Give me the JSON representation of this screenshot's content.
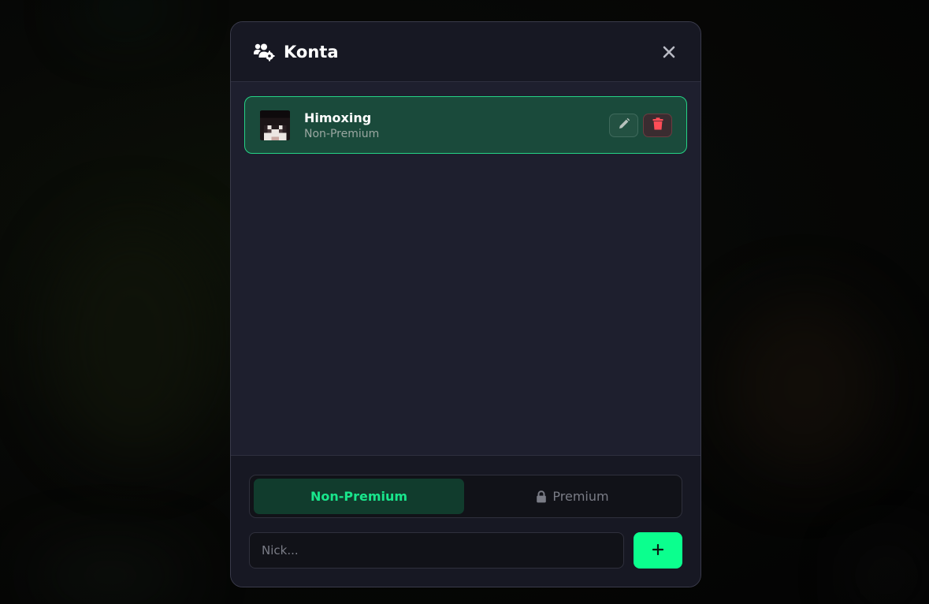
{
  "modal": {
    "title": "Konta",
    "header_icon": "users-gear-icon",
    "close_icon": "close-icon"
  },
  "accounts": [
    {
      "name": "Himoxing",
      "type": "Non-Premium",
      "avatar": "minecraft-skin-head",
      "edit_icon": "pencil-icon",
      "delete_icon": "trash-icon"
    }
  ],
  "account_type_toggle": {
    "options": [
      {
        "label": "Non-Premium",
        "active": true
      },
      {
        "label": "Premium",
        "active": false,
        "icon": "lock-icon"
      }
    ]
  },
  "add_account": {
    "placeholder": "Nick...",
    "button_icon": "plus-icon"
  },
  "colors": {
    "accent": "#0bff8e",
    "card_background": "#1a4a3b",
    "card_border": "#25d386",
    "delete": "#ff4d57",
    "modal_background": "#1e1f2e"
  }
}
